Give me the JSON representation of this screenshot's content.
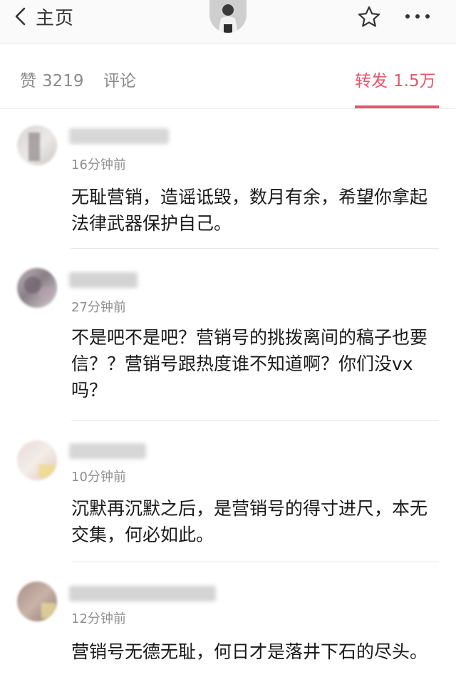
{
  "nav": {
    "back_label": "主页",
    "icons": {
      "back": "chevron-left-icon",
      "star": "star-icon",
      "more": "more-dots-icon"
    }
  },
  "tabs": {
    "likes": {
      "label": "赞",
      "count": "3219"
    },
    "comments": {
      "label": "评论"
    },
    "reposts": {
      "label": "转发",
      "count": "1.5万",
      "active": true
    }
  },
  "colors": {
    "accent": "#e8546b",
    "text": "#1a1a1a",
    "muted": "#8f8f8f"
  },
  "comments": [
    {
      "time": "16分钟前",
      "text": "无耻营销，造谣诋毁，数月有余，希望你拿起法律武器保护自己。"
    },
    {
      "time": "27分钟前",
      "text": "不是吧不是吧？营销号的挑拨离间的稿子也要信？？营销号跟热度谁不知道啊？你们没vx吗？"
    },
    {
      "time": "10分钟前",
      "text": "沉默再沉默之后，是营销号的得寸进尺，本无交集，何必如此。"
    },
    {
      "time": "12分钟前",
      "text": "营销号无德无耻，何日才是落井下石的尽头。"
    }
  ]
}
